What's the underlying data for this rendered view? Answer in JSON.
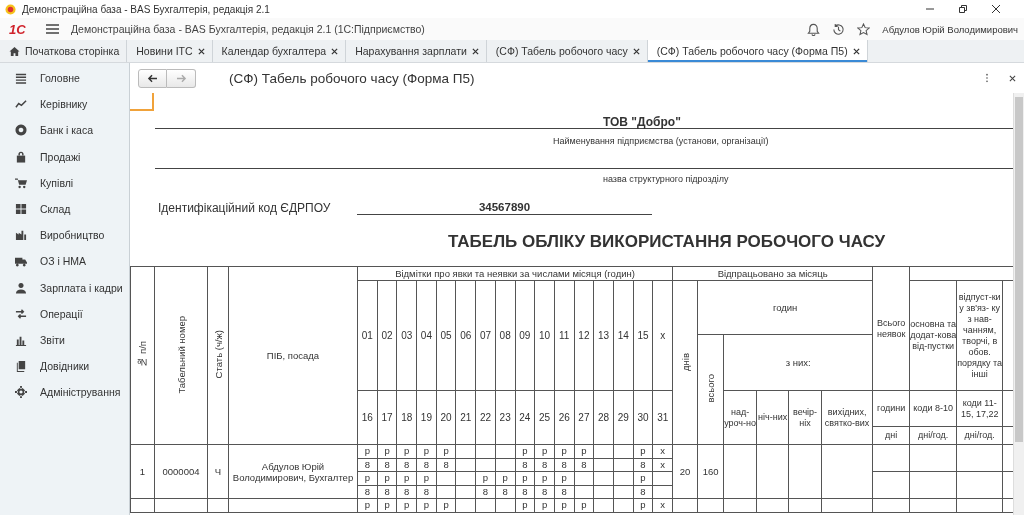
{
  "window": {
    "title": "Демонстраційна база - BAS Бухгалтерія, редакція 2.1"
  },
  "app_bar": {
    "logo": "1С",
    "title": "Демонстраційна база - BAS Бухгалтерія, редакція 2.1  (1С:Підприємство)",
    "user": "Абдулов Юрій Володимирович"
  },
  "tabs": [
    {
      "label": "Початкова сторінка",
      "selected": false,
      "kind": "home"
    },
    {
      "label": "Новини ІТС",
      "selected": false,
      "kind": "closable"
    },
    {
      "label": "Календар бухгалтера",
      "selected": false,
      "kind": "closable"
    },
    {
      "label": "Нарахування зарплати",
      "selected": false,
      "kind": "closable"
    },
    {
      "label": "(СФ) Табель робочого часу",
      "selected": false,
      "kind": "closable"
    },
    {
      "label": "(СФ) Табель робочого часу (Форма П5)",
      "selected": true,
      "kind": "closable"
    }
  ],
  "sidebar": {
    "items": [
      "Головне",
      "Керівнику",
      "Банк і каса",
      "Продажі",
      "Купівлі",
      "Склад",
      "Виробництво",
      "ОЗ і НМА",
      "Зарплата і кадри",
      "Операції",
      "Звіти",
      "Довідники",
      "Адміністрування"
    ]
  },
  "form": {
    "title": "(СФ) Табель робочого часу (Форма П5)",
    "nav_buttons": [
      {
        "kind": "back",
        "disabled": false
      },
      {
        "kind": "forward",
        "disabled": true
      }
    ]
  },
  "document": {
    "company": "ТОВ \"Добро\"",
    "company_caption": "Найменування  підприємства (установи, організації)",
    "department_caption": "назва структурного підрозділу",
    "code_label": "Ідентифікаційний код  ЄДРПОУ",
    "code_value": "34567890",
    "heading": "ТАБЕЛЬ ОБЛІКУ ВИКОРИСТАННЯ РОБОЧОГО ЧАСУ",
    "table": {
      "headers": {
        "number": "№  п/п",
        "tab_number": "Табельний  номер",
        "sex": "Стать  (ч/ж)",
        "name": "ПІБ, посада",
        "marks": "Відмітки  про явки та неявки за числами місяця (годин)",
        "days_1": [
          "01",
          "02",
          "03",
          "04",
          "05",
          "06",
          "07",
          "08",
          "09",
          "10",
          "11",
          "12",
          "13",
          "14",
          "15",
          "х"
        ],
        "days_2": [
          "16",
          "17",
          "18",
          "19",
          "20",
          "21",
          "22",
          "23",
          "24",
          "25",
          "26",
          "27",
          "28",
          "29",
          "30",
          "31"
        ],
        "worked": "Відпрацьовано за місяць",
        "days": "днів",
        "hours": "годин",
        "total": "всього",
        "of_which": "з них:",
        "overtime": "над-уроч-но",
        "night": "ніч-них",
        "evening": "вечір-ніх",
        "holidays": "вихідних, святко-вих",
        "absences": "Всього неявок",
        "absence_hours": "години",
        "absence_days": "дні",
        "leave_main": "основна та додат-кова від-пустки",
        "leave_main_codes": "коди 8-10",
        "leave_main_unit": "дні/год.",
        "leave_study": "відпуст-ки у зв'яз- ку з нав-чанням, творчі, в обов. порядку та інші",
        "leave_study_codes": "коди 11-15, 17,22",
        "leave_study_unit": "дні/год."
      },
      "rows": [
        {
          "number": "1",
          "tab_number": "0000004",
          "sex": "Ч",
          "name": "Абдулов Юрій Володимирович, Бухгалтер",
          "days": "20",
          "hours": "160",
          "marks": [
            {
              "0": "р",
              "1": "р",
              "2": "р",
              "3": "р",
              "4": "р",
              "8": "р",
              "9": "р",
              "10": "р",
              "11": "р",
              "14": "р",
              "15": "х"
            },
            {
              "0": "8",
              "1": "8",
              "2": "8",
              "3": "8",
              "4": "8",
              "8": "8",
              "9": "8",
              "10": "8",
              "11": "8",
              "14": "8",
              "15": "х"
            },
            {
              "0": "р",
              "1": "р",
              "2": "р",
              "3": "р",
              "6": "р",
              "7": "р",
              "8": "р",
              "9": "р",
              "10": "р",
              "14": "р"
            },
            {
              "0": "8",
              "1": "8",
              "2": "8",
              "3": "8",
              "6": "8",
              "7": "8",
              "8": "8",
              "9": "8",
              "10": "8",
              "14": "8"
            }
          ]
        },
        {
          "marks": [
            {
              "0": "р",
              "1": "р",
              "2": "р",
              "3": "р",
              "4": "р",
              "8": "р",
              "9": "р",
              "10": "р",
              "11": "р",
              "14": "р",
              "15": "х"
            }
          ]
        }
      ]
    }
  }
}
